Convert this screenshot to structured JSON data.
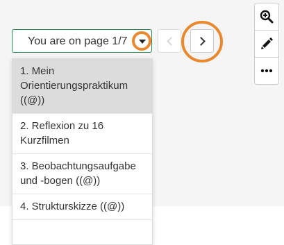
{
  "pager": {
    "label": "You are on page 1/7",
    "prev_label": "<",
    "next_label": ">"
  },
  "toolbar": {
    "zoom_icon": "zoom-in-icon",
    "edit_icon": "pencil-icon",
    "more_icon": "more-icon"
  },
  "menu": {
    "items": [
      {
        "label": "1. Mein Orientierungspraktikum ((@))",
        "selected": true
      },
      {
        "label": "2. Reflexion zu 16 Kurzfilmen",
        "selected": false
      },
      {
        "label": "3. Beobachtungsaufgabe und -bogen ((@))",
        "selected": false
      },
      {
        "label": "4. Strukturskizze ((@))",
        "selected": false
      }
    ]
  },
  "colors": {
    "accent_border": "#2e8b57",
    "highlight_ring": "#e8892f",
    "selected_bg": "#dcdcdc"
  }
}
